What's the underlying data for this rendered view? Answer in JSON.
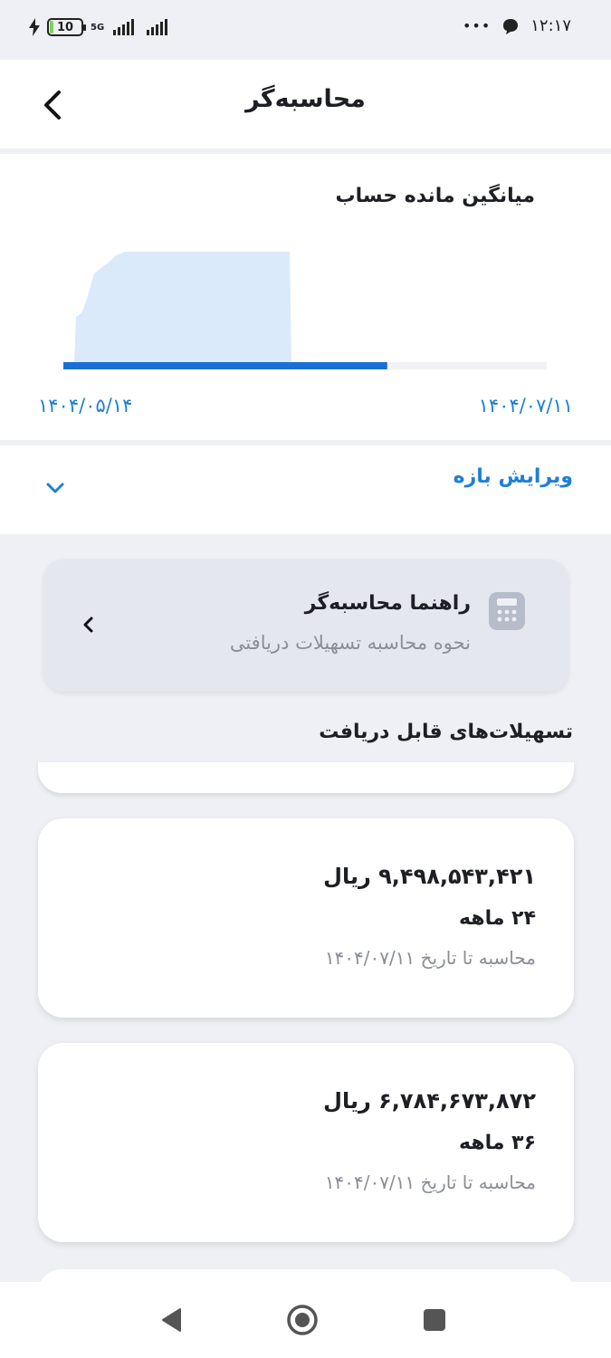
{
  "status_bar": {
    "battery": "10",
    "battery_level": 0.1,
    "network": "5G",
    "time": "۱۲:۱۷",
    "dots": "•••",
    "icons": [
      "charging-icon",
      "battery-icon",
      "signal-icon",
      "signal-icon",
      "more-dots-icon",
      "message-icon"
    ]
  },
  "header": {
    "title": "محاسبه‌گر",
    "back_icon": "chevron-left-icon"
  },
  "balance_chart": {
    "title": "میانگین مانده حساب",
    "start_date": "۱۴۰۴/۰۵/۱۴",
    "end_date": "۱۴۰۴/۰۷/۱۱",
    "selected_fraction": 0.67,
    "accent": "#1a6fd6",
    "area_fill": "#dbeafb"
  },
  "range_editor": {
    "label": "ویرایش بازه",
    "chevron_icon": "chevron-down-icon"
  },
  "guide": {
    "title": "راهنما محاسبه‌گر",
    "subtitle": "نحوه محاسبه تسهیلات دریافتی",
    "icon": "calculator-icon",
    "arrow_icon": "chevron-left-icon"
  },
  "loans": {
    "section_title": "تسهیلات‌های قابل دریافت",
    "items": [
      {
        "amount": "۹,۴۹۸,۵۴۳,۴۲۱ ریال",
        "months": "۲۴ ماهه",
        "note": "محاسبه تا تاریخ ۱۴۰۴/۰۷/۱۱"
      },
      {
        "amount": "۶,۷۸۴,۶۷۳,۸۷۲ ریال",
        "months": "۳۶ ماهه",
        "note": "محاسبه تا تاریخ ۱۴۰۴/۰۷/۱۱"
      }
    ]
  },
  "nav_bar": {
    "icons": [
      "back-triangle-icon",
      "home-circle-icon",
      "recents-square-icon"
    ]
  }
}
